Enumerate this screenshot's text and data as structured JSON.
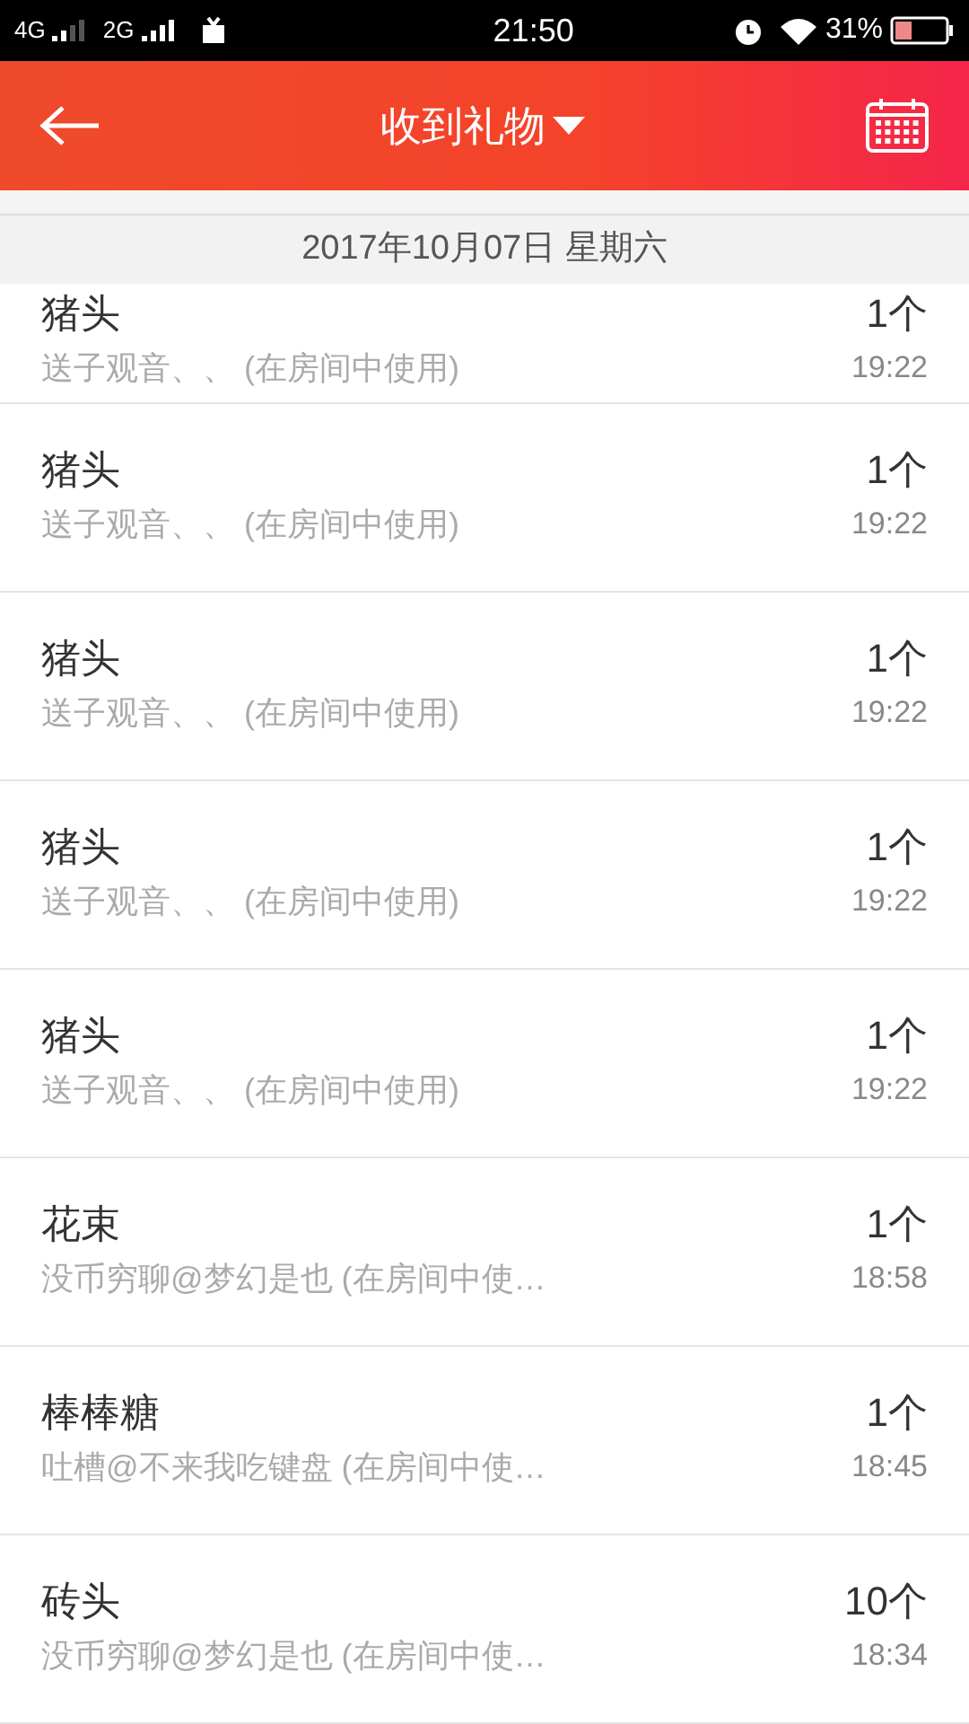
{
  "status_bar": {
    "network_1": "4G",
    "network_2": "2G",
    "time": "21:50",
    "battery": "31%"
  },
  "header": {
    "title": "收到礼物"
  },
  "date_banner": "2017年10月07日 星期六",
  "gifts": [
    {
      "name": "猪头",
      "note": "送子观音、、 (在房间中使用)",
      "count": "1个",
      "time": "19:22"
    },
    {
      "name": "猪头",
      "note": "送子观音、、 (在房间中使用)",
      "count": "1个",
      "time": "19:22"
    },
    {
      "name": "猪头",
      "note": "送子观音、、 (在房间中使用)",
      "count": "1个",
      "time": "19:22"
    },
    {
      "name": "猪头",
      "note": "送子观音、、 (在房间中使用)",
      "count": "1个",
      "time": "19:22"
    },
    {
      "name": "猪头",
      "note": "送子观音、、 (在房间中使用)",
      "count": "1个",
      "time": "19:22"
    },
    {
      "name": "花束",
      "note": "没币穷聊@梦幻是也 (在房间中使…",
      "count": "1个",
      "time": "18:58"
    },
    {
      "name": "棒棒糖",
      "note": "吐槽@不来我吃键盘 (在房间中使…",
      "count": "1个",
      "time": "18:45"
    },
    {
      "name": "砖头",
      "note": "没币穷聊@梦幻是也 (在房间中使…",
      "count": "10个",
      "time": "18:34"
    }
  ]
}
